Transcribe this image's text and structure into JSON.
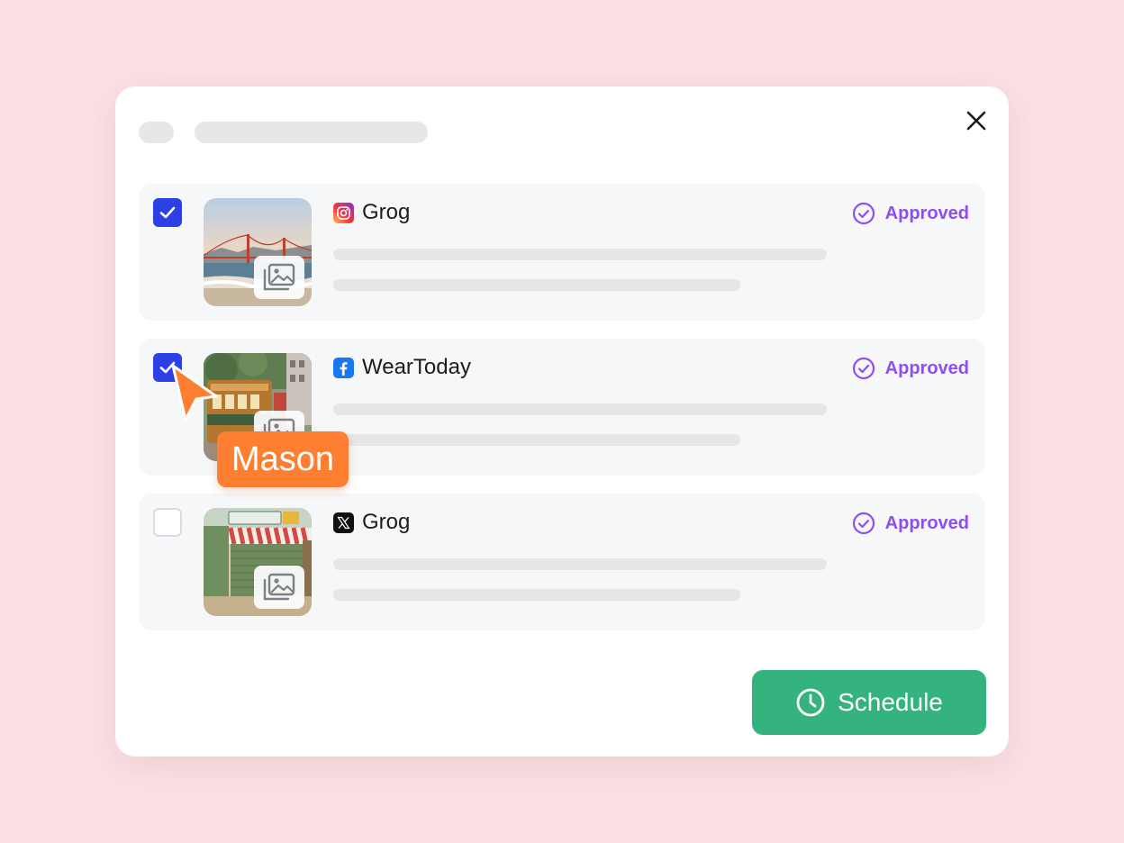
{
  "colors": {
    "background": "#fbe0e4",
    "checkbox_checked": "#2c40e6",
    "approved": "#8e4ef0",
    "schedule_button": "#35b37e",
    "cursor_tag": "#ff7f32"
  },
  "header": {
    "close_icon": "close-icon"
  },
  "posts": [
    {
      "checked": true,
      "platform": "instagram",
      "platform_icon": "instagram-icon",
      "account": "Grog",
      "thumbnail": "golden-gate-bridge-photo",
      "media_icon": "gallery-icon",
      "status": "Approved",
      "status_icon": "check-circle-icon"
    },
    {
      "checked": true,
      "platform": "facebook",
      "platform_icon": "facebook-icon",
      "account": "WearToday",
      "thumbnail": "cable-car-photo",
      "media_icon": "gallery-icon",
      "status": "Approved",
      "status_icon": "check-circle-icon"
    },
    {
      "checked": false,
      "platform": "x",
      "platform_icon": "x-icon",
      "account": "Grog",
      "thumbnail": "storefront-photo",
      "media_icon": "gallery-icon",
      "status": "Approved",
      "status_icon": "check-circle-icon"
    }
  ],
  "footer": {
    "schedule_label": "Schedule",
    "schedule_icon": "clock-icon"
  },
  "collaborator_cursor": {
    "name": "Mason"
  }
}
